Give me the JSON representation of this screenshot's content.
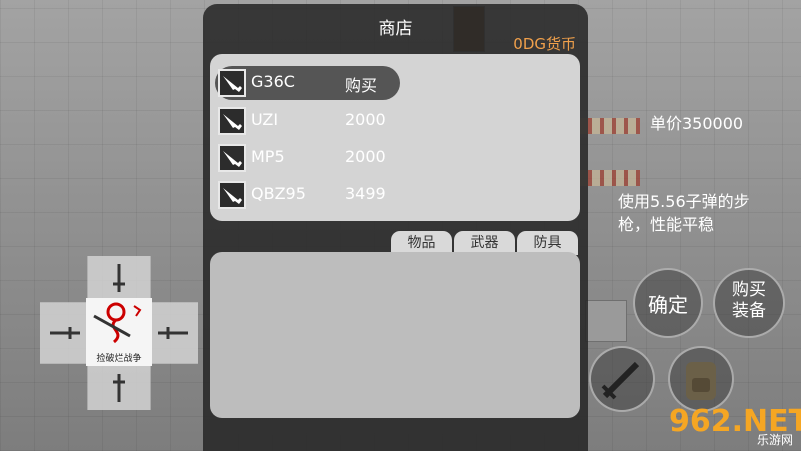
{
  "shop": {
    "title": "商店",
    "currency": "0DG货币",
    "items": [
      {
        "name": "G36C",
        "price": "购买",
        "icon": "gun-icon",
        "selected": true
      },
      {
        "name": "UZI",
        "price": "2000",
        "icon": "gun-icon"
      },
      {
        "name": "MP5",
        "price": "2000",
        "icon": "gun-icon"
      },
      {
        "name": "QBZ95",
        "price": "3499",
        "icon": "gun-icon"
      }
    ],
    "tabs": [
      "物品",
      "武器",
      "防具"
    ]
  },
  "detail": {
    "unit_price": "单价350000",
    "description": "使用5.56子弹的步枪，性能平稳"
  },
  "buttons": {
    "confirm": "确定",
    "buy_equip": "购买\n装备"
  },
  "dpad": {
    "logo_text": "捡破烂战争"
  },
  "watermark": {
    "num": "962.NET",
    "text": "乐游网"
  }
}
